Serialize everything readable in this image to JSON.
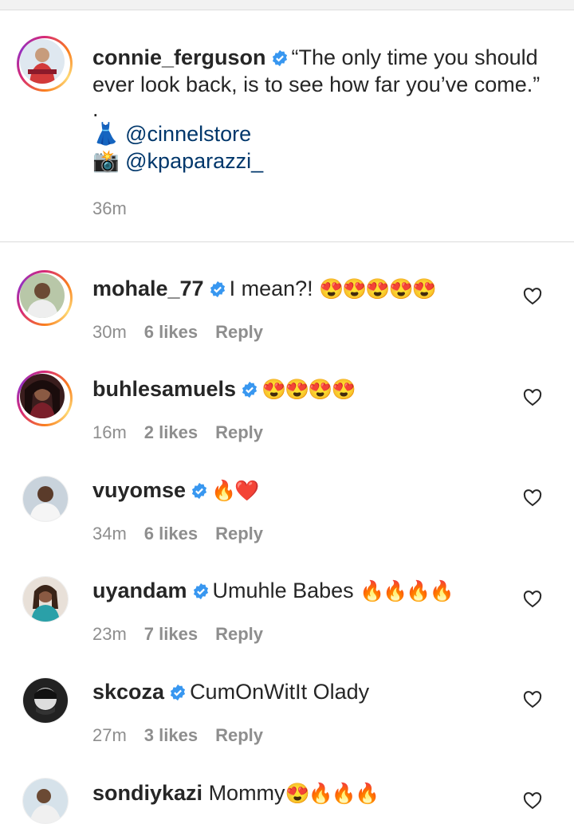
{
  "caption": {
    "username": "connie_ferguson",
    "line1": "“The only time you should",
    "line2": "ever look back, is to see how far you’ve come.”",
    "dot": ".",
    "dress_emoji": "👗",
    "mention1": "@cinnelstore",
    "camera_emoji": "📸",
    "mention2": "@kpaparazzi_",
    "time": "36m"
  },
  "comments": [
    {
      "username": "mohale_77",
      "verified": true,
      "text": "I mean?! ",
      "emoji": "😍😍😍😍😍",
      "time": "30m",
      "likes": "6 likes",
      "reply": "Reply"
    },
    {
      "username": "buhlesamuels",
      "verified": true,
      "text": "",
      "emoji": "😍😍😍😍",
      "time": "16m",
      "likes": "2 likes",
      "reply": "Reply"
    },
    {
      "username": "vuyomse",
      "verified": true,
      "text": "",
      "emoji": "🔥❤️",
      "time": "34m",
      "likes": "6 likes",
      "reply": "Reply"
    },
    {
      "username": "uyandam",
      "verified": true,
      "text": "Umuhle Babes ",
      "emoji": "🔥🔥🔥🔥",
      "time": "23m",
      "likes": "7 likes",
      "reply": "Reply"
    },
    {
      "username": "skcoza",
      "verified": true,
      "text": "CumOnWitIt Olady",
      "emoji": "",
      "time": "27m",
      "likes": "3 likes",
      "reply": "Reply"
    },
    {
      "username": "sondiykazi",
      "verified": false,
      "text": "Mommy",
      "emoji": "😍🔥🔥🔥",
      "time": "",
      "likes": "",
      "reply": ""
    }
  ],
  "colors": {
    "verified": "#3897f0",
    "mention": "#00376b",
    "muted": "#8e8e8e"
  }
}
